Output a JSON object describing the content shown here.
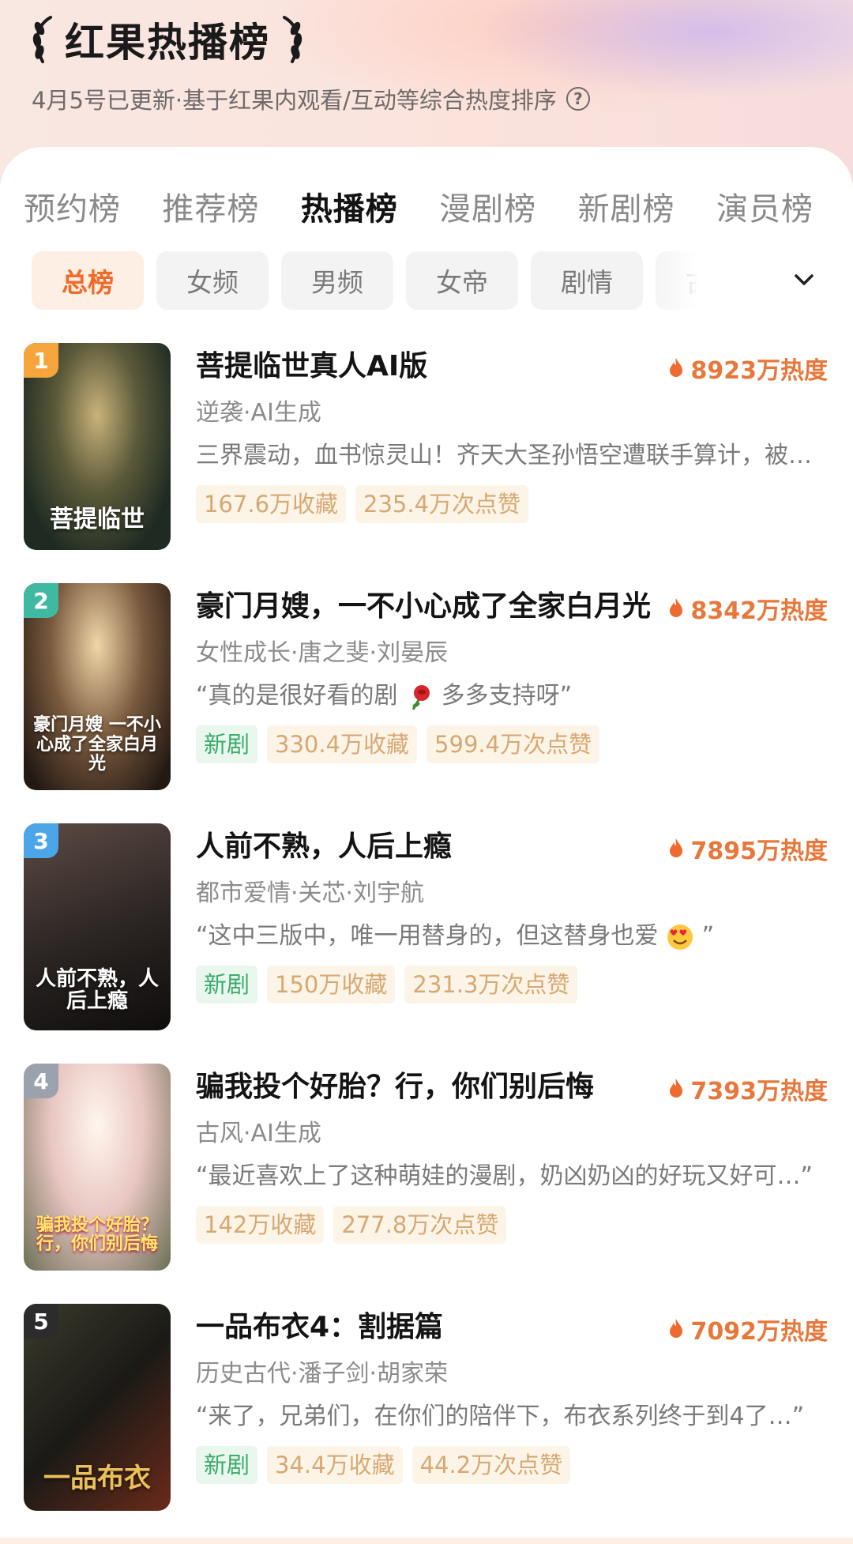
{
  "header": {
    "title": "红果热播榜",
    "subtitle": "4月5号已更新·基于红果内观看/互动等综合热度排序"
  },
  "tabs": [
    {
      "label": "预约榜",
      "active": false
    },
    {
      "label": "推荐榜",
      "active": false
    },
    {
      "label": "热播榜",
      "active": true
    },
    {
      "label": "漫剧榜",
      "active": false
    },
    {
      "label": "新剧榜",
      "active": false
    },
    {
      "label": "演员榜",
      "active": false
    }
  ],
  "chips": [
    {
      "label": "总榜",
      "active": true
    },
    {
      "label": "女频",
      "active": false
    },
    {
      "label": "男频",
      "active": false
    },
    {
      "label": "女帝",
      "active": false
    },
    {
      "label": "剧情",
      "active": false
    },
    {
      "label": "古风",
      "active": false
    }
  ],
  "colors": {
    "accent": "#f06a2a",
    "heat": "#e8773b",
    "rank1": "#f5a53c",
    "rank2": "#3fb9a1",
    "rank3": "#4aa6e8",
    "rank4": "#9aa3ad",
    "rank5": "#2c2c2c"
  },
  "items": [
    {
      "rank": "1",
      "title": "菩提临世真人AI版",
      "heat": "8923万热度",
      "tags": "逆袭·AI生成",
      "desc": "三界震动，血书惊灵山！齐天大圣孙悟空遭联手算计，被…",
      "badges": [
        "167.6万收藏",
        "235.4万次点赞"
      ],
      "new_label": "",
      "poster_text": "菩提临世"
    },
    {
      "rank": "2",
      "title": "豪门月嫂，一不小心成了全家白月光",
      "heat": "8342万热度",
      "tags": "女性成长·唐之斐·刘晏辰",
      "desc_before": "“真的是很好看的剧",
      "desc_after": "多多支持呀”",
      "emoji": "rose",
      "badges": [
        "330.4万收藏",
        "599.4万次点赞"
      ],
      "new_label": "新剧",
      "poster_text": "豪门月嫂 一不小心成了全家白月光"
    },
    {
      "rank": "3",
      "title": "人前不熟，人后上瘾",
      "heat": "7895万热度",
      "tags": "都市爱情·关芯·刘宇航",
      "desc_before": "“这中三版中，唯一用替身的，但这替身也爱",
      "desc_after": "”",
      "emoji": "heart-eyes",
      "badges": [
        "150万收藏",
        "231.3万次点赞"
      ],
      "new_label": "新剧",
      "poster_text": "人前不熟，人后上瘾"
    },
    {
      "rank": "4",
      "title": "骗我投个好胎？行，你们别后悔",
      "heat": "7393万热度",
      "tags": "古风·AI生成",
      "desc": "“最近喜欢上了这种萌娃的漫剧，奶凶奶凶的好玩又好可…”",
      "badges": [
        "142万收藏",
        "277.8万次点赞"
      ],
      "new_label": "",
      "poster_text": "骗我投个好胎？行，你们别后悔"
    },
    {
      "rank": "5",
      "title": "一品布衣4：割据篇",
      "heat": "7092万热度",
      "tags": "历史古代·潘子剑·胡家荣",
      "desc": "“来了，兄弟们，在你们的陪伴下，布衣系列终于到4了…”",
      "badges": [
        "34.4万收藏",
        "44.2万次点赞"
      ],
      "new_label": "新剧",
      "poster_text": "一品布衣"
    }
  ]
}
